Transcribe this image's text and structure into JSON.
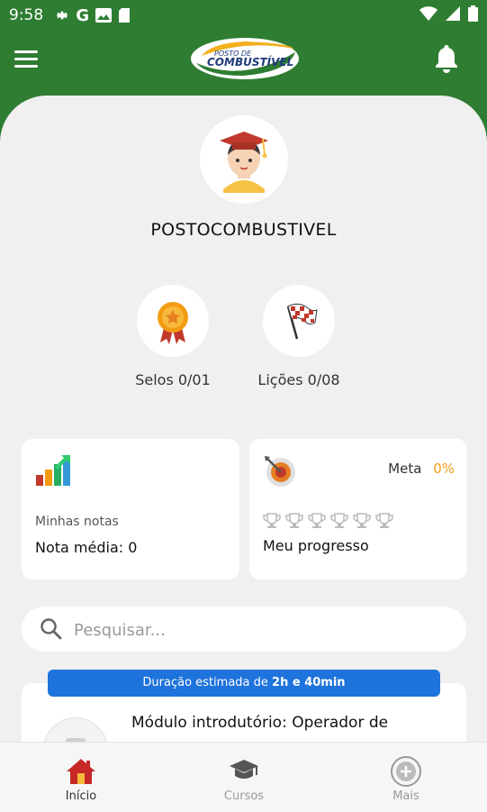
{
  "status_bar": {
    "time": "9:58"
  },
  "profile": {
    "username": "POSTOCOMBUSTIVEL"
  },
  "badges": [
    {
      "label": "Selos 0/01"
    },
    {
      "label": "Lições 0/08"
    }
  ],
  "cards": {
    "notes": {
      "title": "Minhas notas",
      "value": "Nota média: 0"
    },
    "progress": {
      "meta_label": "Meta",
      "meta_value": "0%",
      "title": "Meu progresso"
    }
  },
  "search": {
    "placeholder": "Pesquisar..."
  },
  "course": {
    "duration_prefix": "Duração estimada de",
    "duration_value": "2h e 40min",
    "title": "Módulo introdutório: Operador de"
  },
  "bottom_nav": [
    {
      "label": "Início"
    },
    {
      "label": "Cursos"
    },
    {
      "label": "Mais"
    }
  ],
  "colors": {
    "header_green": "#2e7d32",
    "accent_orange": "#f39c12",
    "duration_blue": "#1e73dc",
    "active_nav": "#c62828"
  },
  "icons": [
    "menu-icon",
    "bell-icon",
    "medal-icon",
    "checkered-flag-icon",
    "bar-chart-icon",
    "target-icon",
    "trophy-icon",
    "search-icon",
    "home-icon",
    "graduation-cap-icon",
    "plus-circle-icon"
  ]
}
